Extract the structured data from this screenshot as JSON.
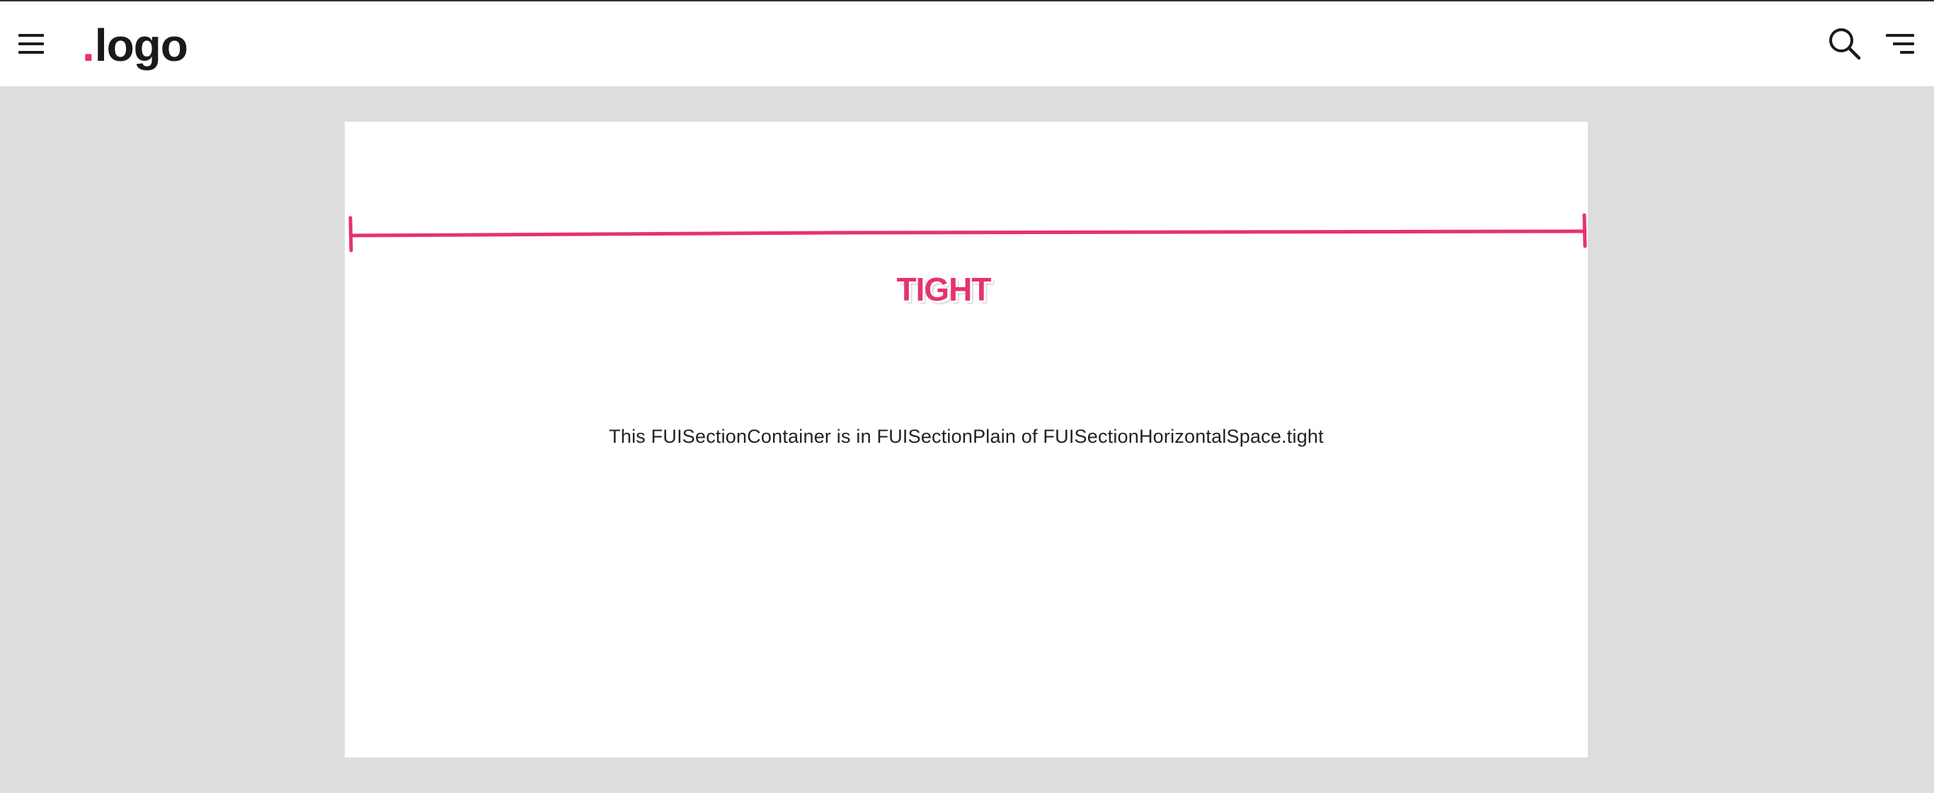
{
  "header": {
    "menu_icon": "hamburger-menu-icon",
    "logo": {
      "dot": ".",
      "text": "logo"
    },
    "search_icon": "search-icon",
    "filter_icon": "filter-lines-icon"
  },
  "section": {
    "space_label": "TIGHT",
    "description": "This FUISectionContainer is in FUISectionPlain of FUISectionHorizontalSpace.tight"
  },
  "colors": {
    "accent": "#e6336b",
    "stage_background": "#dddddd",
    "card_background": "#ffffff",
    "text": "#1a1a1a"
  }
}
